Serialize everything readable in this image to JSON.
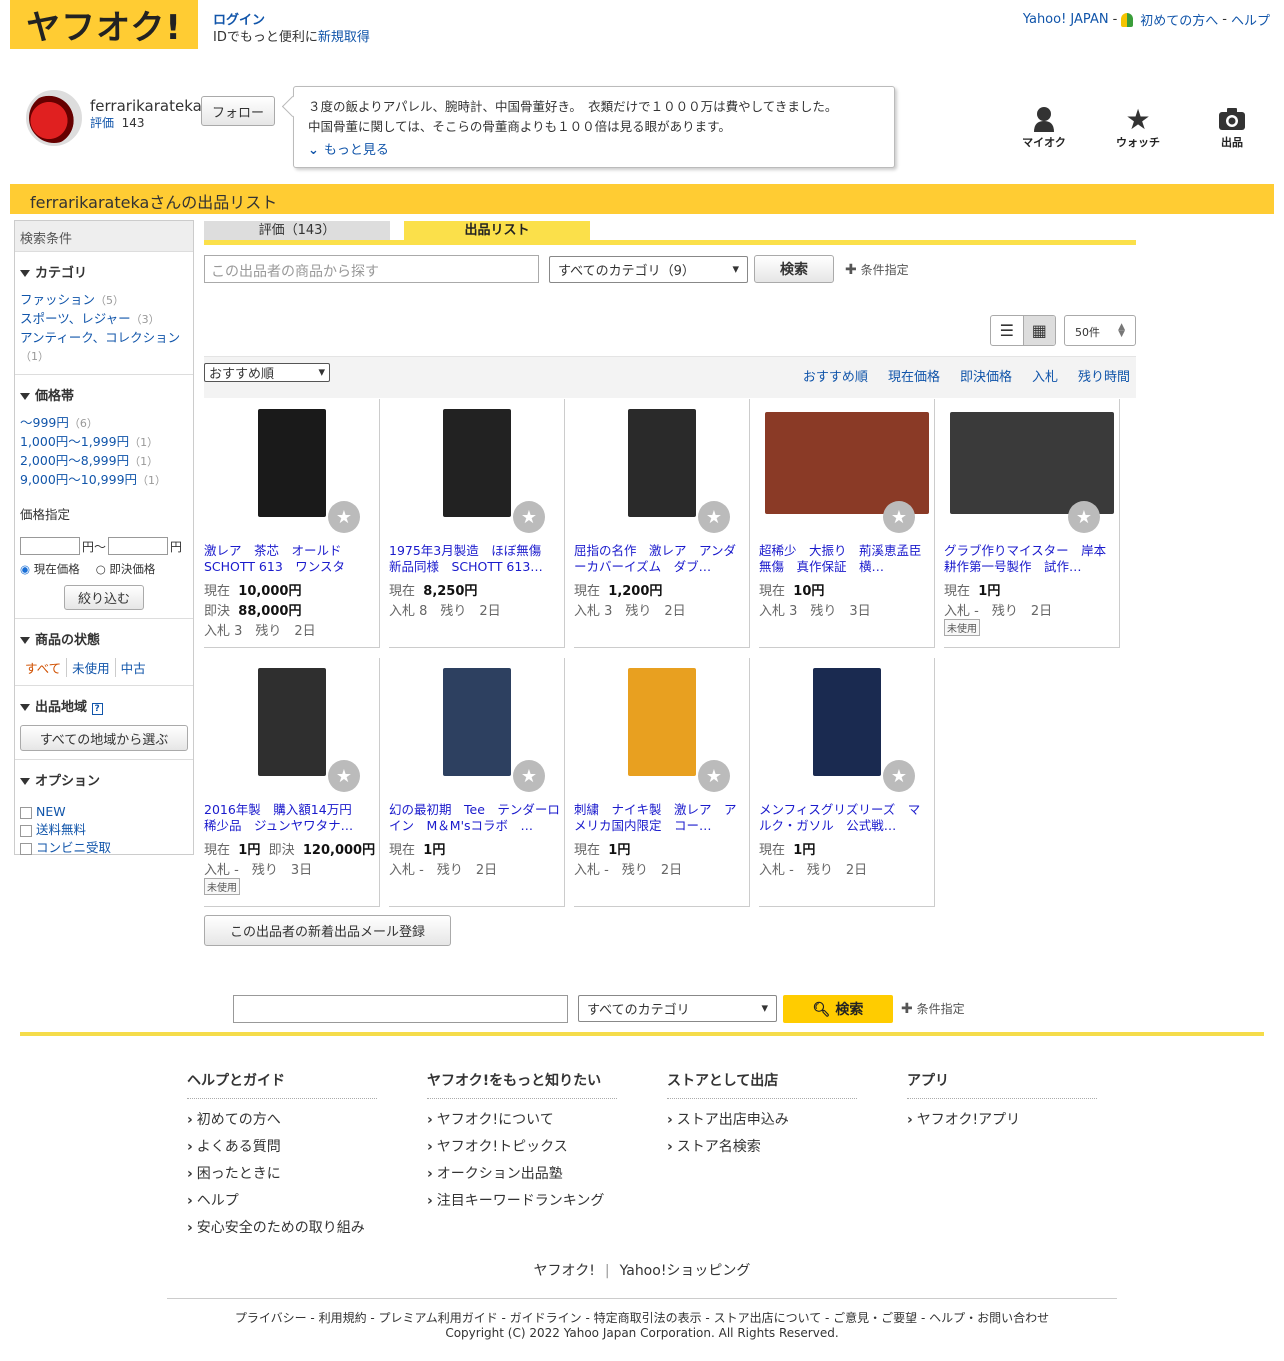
{
  "header": {
    "logo": "ヤフオク!",
    "login": "ログイン",
    "id_text": "IDでもっと便利に",
    "signup": "新規取得",
    "yahoo_japan": "Yahoo! JAPAN",
    "beginner": "初めての方へ",
    "help": "ヘルプ",
    "sep": "-"
  },
  "profile": {
    "name": "ferrarikarateka",
    "rating_label": "評価",
    "rating_count": "143",
    "follow": "フォロー",
    "bio_line1": "３度の飯よりアパレル、腕時計、中国骨董好き。　衣類だけで１０００万は費やしてきました。",
    "bio_line2": "中国骨董に関しては、そこらの骨董商よりも１００倍は見る眼があります。",
    "more": "もっと見る"
  },
  "nav": {
    "myauction": "マイオク",
    "watch": "ウォッチ",
    "sell": "出品"
  },
  "title": "ferrarikaratekaさんの出品リスト",
  "sidebar": {
    "header": "検索条件",
    "category_title": "カテゴリ",
    "categories": [
      {
        "label": "ファッション",
        "count": "（5）"
      },
      {
        "label": "スポーツ、レジャー",
        "count": "（3）"
      },
      {
        "label": "アンティーク、コレクション",
        "count": "（1）"
      }
    ],
    "price_title": "価格帯",
    "prices": [
      {
        "label": "〜999円",
        "count": "（6）"
      },
      {
        "label": "1,000円〜1,999円",
        "count": "（1）"
      },
      {
        "label": "2,000円〜8,999円",
        "count": "（1）"
      },
      {
        "label": "9,000円〜10,999円",
        "count": "（1）"
      }
    ],
    "price_spec": "価格指定",
    "yen_from": "円～",
    "yen_to": "円",
    "current": "現在価格",
    "buynow": "即決価格",
    "narrow": "絞り込む",
    "condition_title": "商品の状態",
    "conditions": [
      "すべて",
      "未使用",
      "中古"
    ],
    "region_title": "出品地域",
    "region_help": "?",
    "region_btn": "すべての地域から選ぶ",
    "option_title": "オプション",
    "options": [
      "NEW",
      "送料無料",
      "コンビニ受取"
    ]
  },
  "tabs": {
    "rating": "評価（143）",
    "listing": "出品リスト"
  },
  "search": {
    "placeholder": "この出品者の商品から探す",
    "category": "すべてのカテゴリ（9）",
    "button": "検索",
    "cond": "条件指定"
  },
  "view": {
    "perpage": "50件"
  },
  "sort": {
    "selected": "おすすめ順",
    "links": [
      "おすすめ順",
      "現在価格",
      "即決価格",
      "入札",
      "残り時間"
    ]
  },
  "items": [
    {
      "title": "激レア　茶芯　オールド SCHOTT 613　ワンスター　…",
      "l1k": "現在",
      "l1v": "10,000円",
      "l2k": "即決",
      "l2v": "88,000円",
      "l3": "入札 3　残り　2日",
      "badge": "",
      "img": "#1a1a1a"
    },
    {
      "title": "1975年3月製造　ほぼ無傷　新品同様　SCHOTT 613…",
      "l1k": "現在",
      "l1v": "8,250円",
      "l2": "入札 8　残り　2日",
      "badge": "",
      "img": "#222"
    },
    {
      "title": "屈指の名作　激レア　アンダーカバーイズム　ダブ…",
      "l1k": "現在",
      "l1v": "1,200円",
      "l2": "入札 3　残り　2日",
      "badge": "",
      "img": "#2a2a2a"
    },
    {
      "title": "超稀少　大振り　荊溪恵孟臣　無傷　真作保証　横…",
      "l1k": "現在",
      "l1v": "10円",
      "l2": "入札 3　残り　3日",
      "badge": "",
      "img": "#8a3a26"
    },
    {
      "title": "グラブ作りマイスター　岸本耕作第一号製作　試作…",
      "l1k": "現在",
      "l1v": "1円",
      "l2": "入札 -　残り　2日",
      "badge": "未使用",
      "img": "#3a3a3a"
    },
    {
      "title": "2016年製　購入額14万円　稀少品　ジュンヤワタナ…",
      "l1k": "現在",
      "l1v": "1円",
      "l1k2": "即決",
      "l1v2": "120,000円",
      "l2": "入札 -　残り　3日",
      "badge": "未使用",
      "img": "#2f2f2f"
    },
    {
      "title": "幻の最初期　Tee　テンダーロイン　M＆M'sコラボ　…",
      "l1k": "現在",
      "l1v": "1円",
      "l2": "入札 -　残り　2日",
      "badge": "",
      "img": "#2d4060"
    },
    {
      "title": "刺繍　ナイキ製　激レア　アメリカ国内限定　コー…",
      "l1k": "現在",
      "l1v": "1円",
      "l2": "入札 -　残り　2日",
      "badge": "",
      "img": "#e8a020"
    },
    {
      "title": "メンフィスグリズリーズ　マルク・ガソル　公式戦…",
      "l1k": "現在",
      "l1v": "1円",
      "l2": "入札 -　残り　2日",
      "badge": "",
      "img": "#1a2a50"
    }
  ],
  "mail_btn": "この出品者の新着出品メール登録",
  "footer": {
    "category": "すべてのカテゴリ",
    "search": "検索",
    "cond": "条件指定",
    "cols": [
      {
        "title": "ヘルプとガイド",
        "items": [
          "初めての方へ",
          "よくある質問",
          "困ったときに",
          "ヘルプ",
          "安心安全のための取り組み"
        ]
      },
      {
        "title": "ヤフオク!をもっと知りたい",
        "items": [
          "ヤフオク!について",
          "ヤフオク!トピックス",
          "オークション出品塾",
          "注目キーワードランキング"
        ]
      },
      {
        "title": "ストアとして出店",
        "items": [
          "ストア出店申込み",
          "ストア名検索"
        ]
      },
      {
        "title": "アプリ",
        "items": [
          "ヤフオク!アプリ"
        ]
      }
    ],
    "brand1": "ヤフオク!",
    "brand2": "Yahoo!ショッピング",
    "links": "プライバシー - 利用規約 - プレミアム利用ガイド - ガイドライン - 特定商取引法の表示 - ストア出店について - ご意見・ご要望 - ヘルプ・お問い合わせ",
    "copyright": "Copyright (C) 2022 Yahoo Japan Corporation. All Rights Reserved."
  }
}
